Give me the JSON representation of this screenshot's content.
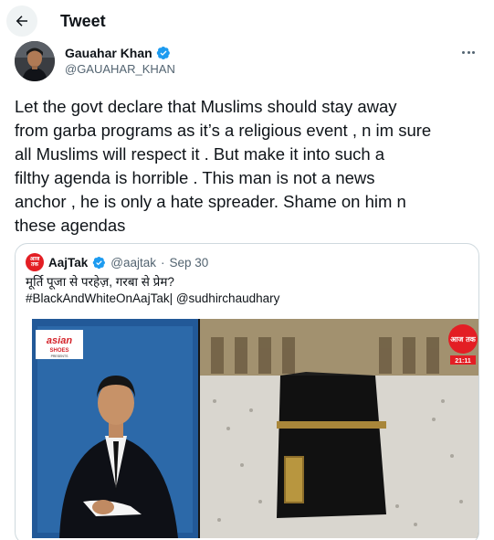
{
  "header": {
    "title": "Tweet",
    "back_icon": "arrow-left-icon"
  },
  "author": {
    "name": "Gauahar Khan",
    "handle": "@GAUAHAR_KHAN",
    "verified_icon": "verified-badge-icon",
    "more_icon": "more-horizontal-icon"
  },
  "tweet": {
    "text": "Let the govt declare that Muslims should stay away\nfrom garba programs as it’s a religious event , n im sure\nall Muslims will respect it . But make it into such a\nfilthy agenda is horrible . This man is not a news\nanchor , he is only a hate spreader. Shame on him n\nthese agendas"
  },
  "quoted_tweet": {
    "name": "AajTak",
    "handle": "@aajtak",
    "separator": "·",
    "date": "Sep 30",
    "line1": "मूर्ति पूजा से परहेज़, गरबा से प्रेम?",
    "line2": "#BlackAndWhiteOnAajTak| @sudhirchaudhary",
    "avatar_text": "आज तक",
    "media": {
      "sponsor_logo": "asian",
      "sponsor_sub": "SHOES",
      "sponsor_sub2": "PRESENTS",
      "channel_logo": "आज तक",
      "clock": "21:11"
    }
  },
  "colors": {
    "text": "#0f1419",
    "secondary": "#536471",
    "verified": "#1d9bf0",
    "border": "#cfd9de",
    "aajtak_red": "#e31e24"
  }
}
